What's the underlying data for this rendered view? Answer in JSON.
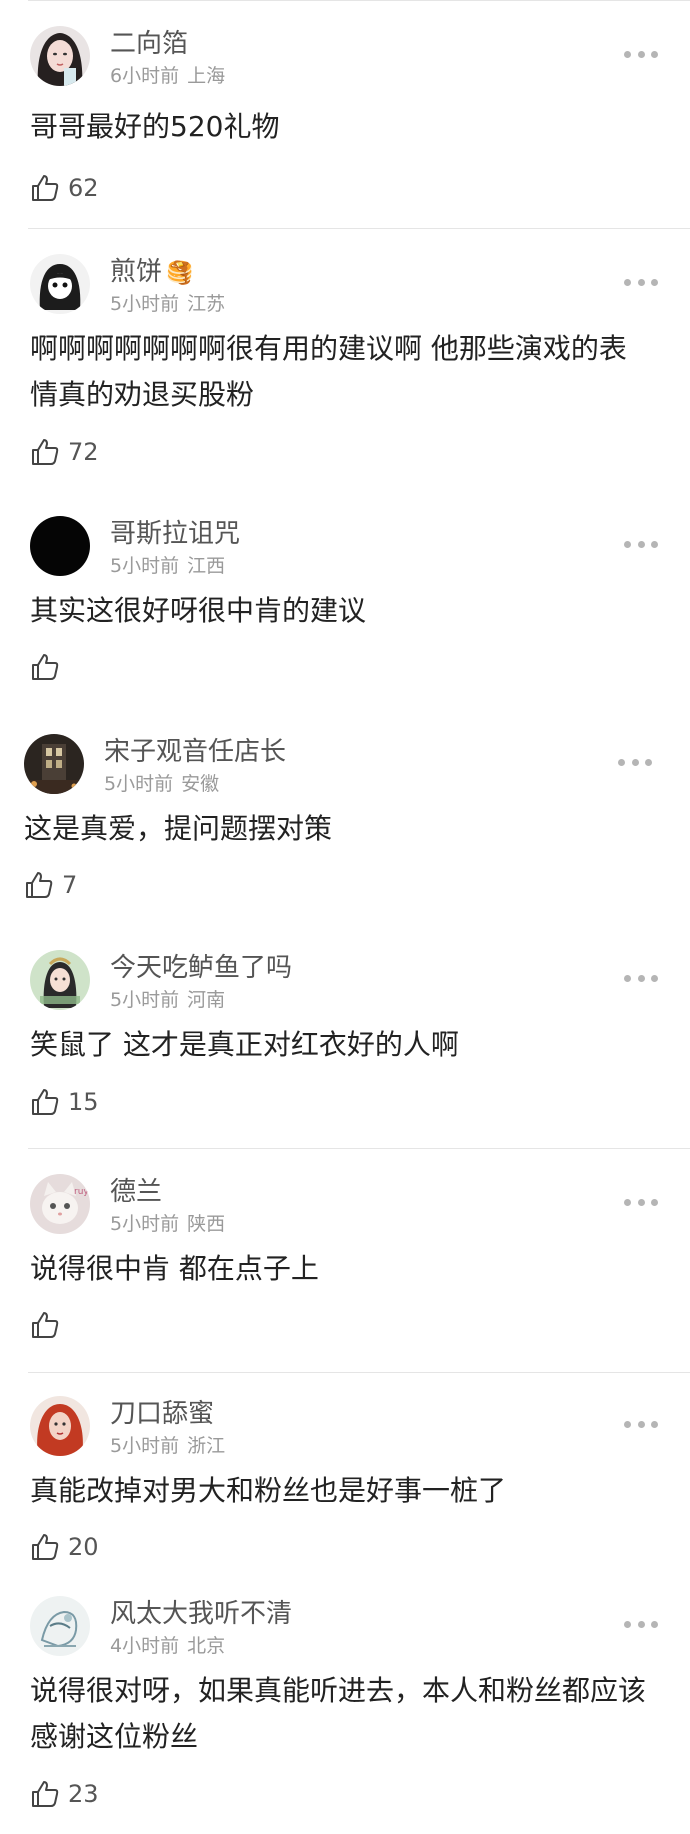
{
  "comments": [
    {
      "username": "二向箔",
      "time": "6小时前",
      "location": "上海",
      "text": "哥哥最好的520礼物",
      "likes": "62",
      "avatar_icon": "girl-portrait-avatar"
    },
    {
      "username": "煎饼",
      "badge": "🥞",
      "time": "5小时前",
      "location": "江苏",
      "text": "啊啊啊啊啊啊啊很有用的建议啊 他那些演戏的表情真的劝退买股粉",
      "likes": "72",
      "avatar_icon": "cartoon-girl-avatar"
    },
    {
      "username": "哥斯拉诅咒",
      "time": "5小时前",
      "location": "江西",
      "text": "其实这很好呀很中肯的建议",
      "likes": "",
      "avatar_icon": "black-circle-avatar"
    },
    {
      "username": "宋子观音任店长",
      "time": "5小时前",
      "location": "安徽",
      "text": "这是真爱，提问题摆对策",
      "likes": "7",
      "avatar_icon": "dark-building-avatar"
    },
    {
      "username": "今天吃鲈鱼了吗",
      "time": "5小时前",
      "location": "河南",
      "text": "笑鼠了 这才是真正对红衣好的人啊",
      "likes": "15",
      "avatar_icon": "costume-girl-avatar"
    },
    {
      "username": "德兰",
      "time": "5小时前",
      "location": "陕西",
      "text": "说得很中肯 都在点子上",
      "likes": "",
      "avatar_icon": "cat-avatar"
    },
    {
      "username": "刀口舔蜜",
      "time": "5小时前",
      "location": "浙江",
      "text": "真能改掉对男大和粉丝也是好事一桩了",
      "likes": "20",
      "avatar_icon": "red-hair-avatar"
    },
    {
      "username": "风太大我听不清",
      "time": "4小时前",
      "location": "北京",
      "text": "说得很对呀，如果真能听进去，本人和粉丝都应该感谢这位粉丝",
      "likes": "23",
      "avatar_icon": "sketch-avatar"
    }
  ],
  "colors": {
    "username": "#555555",
    "meta": "#9a9a9a",
    "text": "#222222",
    "divider": "#e5e5e5"
  },
  "icons": {
    "like": "thumbs-up-icon",
    "more": "more-dots-icon"
  }
}
